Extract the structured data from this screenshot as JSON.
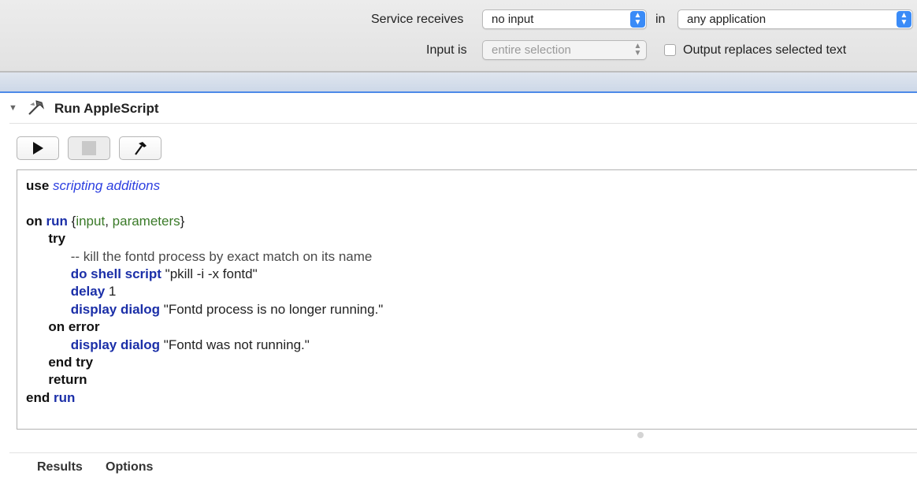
{
  "header": {
    "service_receives_label": "Service receives",
    "service_receives_value": "no input",
    "in_label": "in",
    "application_value": "any application",
    "input_is_label": "Input is",
    "input_is_value": "entire selection",
    "output_replaces_label": "Output replaces selected text",
    "output_replaces_checked": false,
    "accent_color": "#3a8bf7"
  },
  "action": {
    "title": "Run AppleScript",
    "icon": "script-icon",
    "toolbar": {
      "run_icon": "play-icon",
      "stop_icon": "stop-icon",
      "compile_icon": "hammer-icon"
    },
    "code": {
      "l1_kw": "use",
      "l1_rest": "scripting additions",
      "l2_kw": "on",
      "l2_handler": "run",
      "l2_open": "{",
      "l2_p1": "input",
      "l2_comma": ", ",
      "l2_p2": "parameters",
      "l2_close": "}",
      "l3_kw": "try",
      "l4_comment": "-- kill the fontd process by exact match on its name",
      "l5_cmd": "do shell script",
      "l5_arg": "\"pkill -i -x fontd\"",
      "l6_cmd": "delay",
      "l6_arg": "1",
      "l7_cmd": "display dialog",
      "l7_arg": "\"Fontd process is no longer running.\"",
      "l8_kw": "on error",
      "l9_cmd": "display dialog",
      "l9_arg": "\"Fontd was not running.\"",
      "l10_kw": "end try",
      "l11_kw": "return",
      "l12_kw": "end",
      "l12_handler": "run"
    },
    "footer_tabs": [
      "Results",
      "Options"
    ]
  }
}
